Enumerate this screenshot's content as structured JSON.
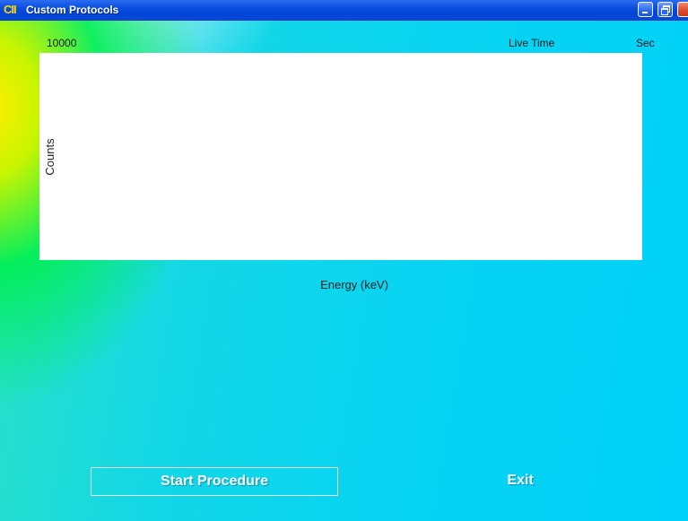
{
  "window": {
    "app_logo": "CII",
    "title": "Custom Protocols",
    "controls": [
      "minimize-icon",
      "restore-icon",
      "close-icon"
    ]
  },
  "spectrum": {
    "y_max": "10000",
    "live_time_label": "Live Time",
    "live_time_unit": "Sec",
    "y_axis_label": "Counts",
    "x_axis_label": "Energy (keV)"
  },
  "actions": {
    "start_label": "Start Procedure",
    "exit_label": "Exit"
  },
  "colors": {
    "title_bar": "#0a4fe0",
    "background_accent": "#00d0f8",
    "plot_background": "#ffffff"
  }
}
